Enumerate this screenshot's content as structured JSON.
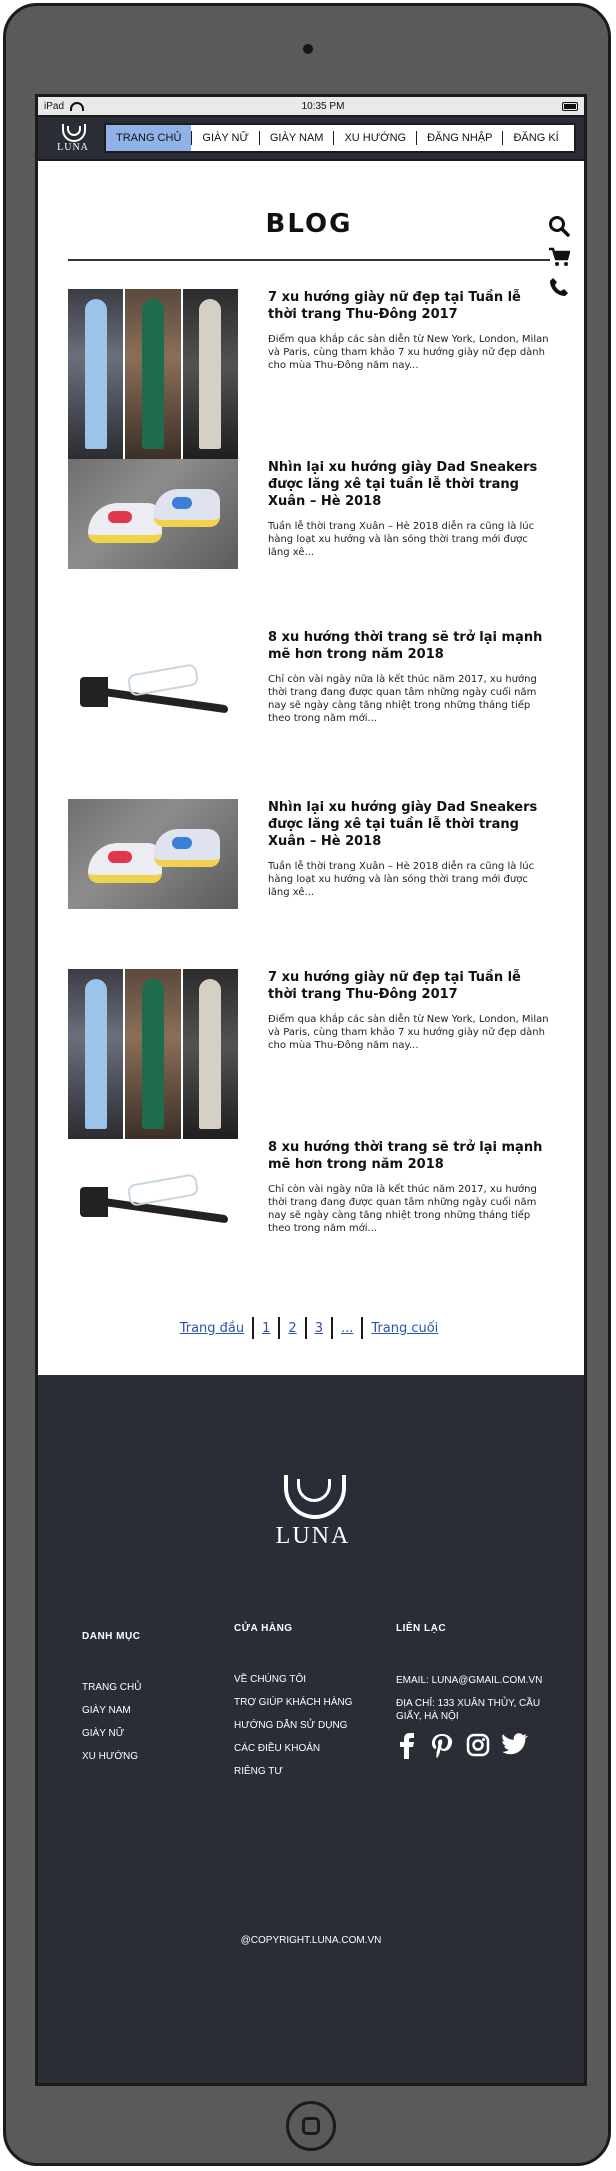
{
  "status": {
    "device": "iPad",
    "time": "10:35 PM"
  },
  "brand": {
    "name": "LUNA"
  },
  "nav": {
    "items": [
      {
        "label": "TRANG CHỦ"
      },
      {
        "label": "GIÀY NỮ"
      },
      {
        "label": "GIÀY NAM"
      },
      {
        "label": "XU HƯỚNG"
      },
      {
        "label": "ĐĂNG NHẬP"
      },
      {
        "label": "ĐĂNG KÍ"
      }
    ],
    "active_index": 0
  },
  "page": {
    "title": "BLOG"
  },
  "posts": [
    {
      "title": "7 xu hướng giày nữ đẹp tại Tuần lễ thời trang Thu-Đông 2017",
      "excerpt": "Điểm qua khắp các sàn diễn từ New York, London, Milan và Paris, cùng tham khảo 7 xu hướng giày nữ đẹp dành cho mùa Thu-Đông năm nay...",
      "image": "runway"
    },
    {
      "title": "Nhìn lại xu hướng giày Dad Sneakers được lăng xê tại tuần lễ thời trang Xuân – Hè 2018",
      "excerpt": "Tuần lễ thời trang Xuân – Hè 2018 diễn ra cũng là lúc hàng loạt xu hướng và làn sóng thời trang mới được lăng xê...",
      "image": "sneaker"
    },
    {
      "title": "8 xu hướng thời trang sẽ trở lại mạnh mẽ hơn trong năm 2018",
      "excerpt": "Chỉ còn vài ngày nữa là kết thúc năm 2017, xu hướng thời trang đang được quan tâm những ngày cuối năm nay sẽ ngày càng tăng nhiệt trong những tháng tiếp theo trong năm mới...",
      "image": "sandal"
    },
    {
      "title": "Nhìn lại xu hướng giày Dad Sneakers được lăng xê tại tuần lễ thời trang Xuân – Hè 2018",
      "excerpt": "Tuần lễ thời trang Xuân – Hè 2018 diễn ra cũng là lúc hàng loạt xu hướng và làn sóng thời trang mới được lăng xê...",
      "image": "sneaker"
    },
    {
      "title": "7 xu hướng giày nữ đẹp tại Tuần lễ thời trang Thu-Đông 2017",
      "excerpt": "Điểm qua khắp các sàn diễn từ New York, London, Milan và Paris, cùng tham khảo 7 xu hướng giày nữ đẹp dành cho mùa Thu-Đông năm nay...",
      "image": "runway"
    },
    {
      "title": "8 xu hướng thời trang sẽ trở lại mạnh mẽ hơn trong năm 2018",
      "excerpt": "Chỉ còn vài ngày nữa là kết thúc năm 2017, xu hướng thời trang đang được quan tâm những ngày cuối năm nay sẽ ngày càng tăng nhiệt trong những tháng tiếp theo trong năm mới...",
      "image": "sandal"
    }
  ],
  "pagination": {
    "first": "Trang đầu",
    "pages": [
      "1",
      "2",
      "3",
      "..."
    ],
    "last": "Trang cuối"
  },
  "footer": {
    "categories": {
      "heading": "DANH MỤC",
      "items": [
        "TRANG CHỦ",
        "GIÀY NAM",
        "GIÀY NỮ",
        "XU HƯỚNG"
      ]
    },
    "store": {
      "heading": "CỬA HÀNG",
      "items": [
        "VỀ CHÚNG TÔI",
        "TRỢ GIÚP KHÁCH HÀNG",
        "HƯỚNG DẪN SỬ DỤNG",
        "CÁC ĐIỀU KHOẢN",
        "RIÊNG TƯ"
      ]
    },
    "contact": {
      "heading": "LIÊN LẠC",
      "email": "EMAIL: LUNA@GMAIL.COM.VN",
      "address": "ĐỊA CHỈ: 133 XUÂN THỦY, CẦU GIẤY, HÀ NỘI"
    },
    "socials": [
      "facebook-icon",
      "pinterest-icon",
      "instagram-icon",
      "twitter-icon"
    ],
    "copyright": "@COPYRIGHT.LUNA.COM.VN"
  },
  "colors": {
    "nav_bg": "#2a2d36",
    "active_tab": "#8fb3e8",
    "link": "#2b55a8",
    "footer_bg": "#2a2d36"
  }
}
